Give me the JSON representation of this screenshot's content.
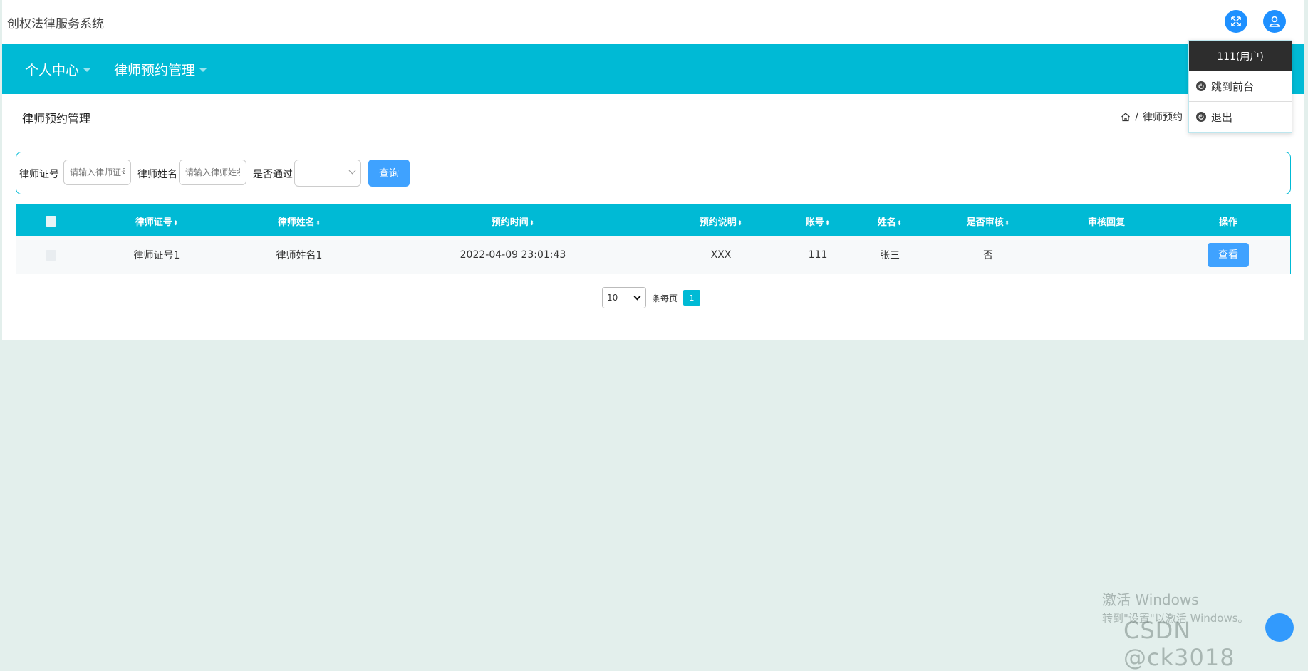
{
  "app": {
    "title": "创权法律服务系统"
  },
  "header": {
    "fullscreen_icon": "fullscreen-icon",
    "user_icon": "user-icon"
  },
  "nav": {
    "items": [
      {
        "label": "个人中心"
      },
      {
        "label": "律师预约管理"
      }
    ]
  },
  "page": {
    "title": "律师预约管理",
    "breadcrumb": {
      "home_icon": "home-icon",
      "separator": "/",
      "current": "律师预约"
    }
  },
  "search": {
    "license_label": "律师证号",
    "license_placeholder": "请输入律师证号",
    "name_label": "律师姓名",
    "name_placeholder": "请输入律师姓名",
    "passed_label": "是否通过",
    "passed_value": "",
    "query_button": "查询"
  },
  "table": {
    "headers": [
      {
        "label": "律师证号",
        "sortable": true
      },
      {
        "label": "律师姓名",
        "sortable": true
      },
      {
        "label": "预约时间",
        "sortable": true
      },
      {
        "label": "预约说明",
        "sortable": true
      },
      {
        "label": "账号",
        "sortable": true
      },
      {
        "label": "姓名",
        "sortable": true
      },
      {
        "label": "是否审核",
        "sortable": true
      },
      {
        "label": "审核回复",
        "sortable": false
      },
      {
        "label": "操作",
        "sortable": false
      }
    ],
    "sort_glyph": "⬍",
    "rows": [
      {
        "license": "律师证号1",
        "lawyer_name": "律师姓名1",
        "time": "2022-04-09 23:01:43",
        "note": "XXX",
        "account": "111",
        "name": "张三",
        "reviewed": "否",
        "reply": "",
        "action": "查看"
      }
    ]
  },
  "pagination": {
    "page_size": "10",
    "per_page_label": "条每页",
    "current_page": "1"
  },
  "user_menu": {
    "header": "111(用户)",
    "items": [
      {
        "label": "跳到前台",
        "icon": "power-icon"
      },
      {
        "label": "退出",
        "icon": "power-icon"
      }
    ]
  },
  "overlay": {
    "activate_title": "激活 Windows",
    "activate_sub": "转到\"设置\"以激活 Windows。",
    "csdn": "CSDN @ck3018"
  },
  "colors": {
    "primary": "#00bad5",
    "button": "#3fa2ff",
    "icon_button": "#1e90ff",
    "background": "#e3efec"
  }
}
